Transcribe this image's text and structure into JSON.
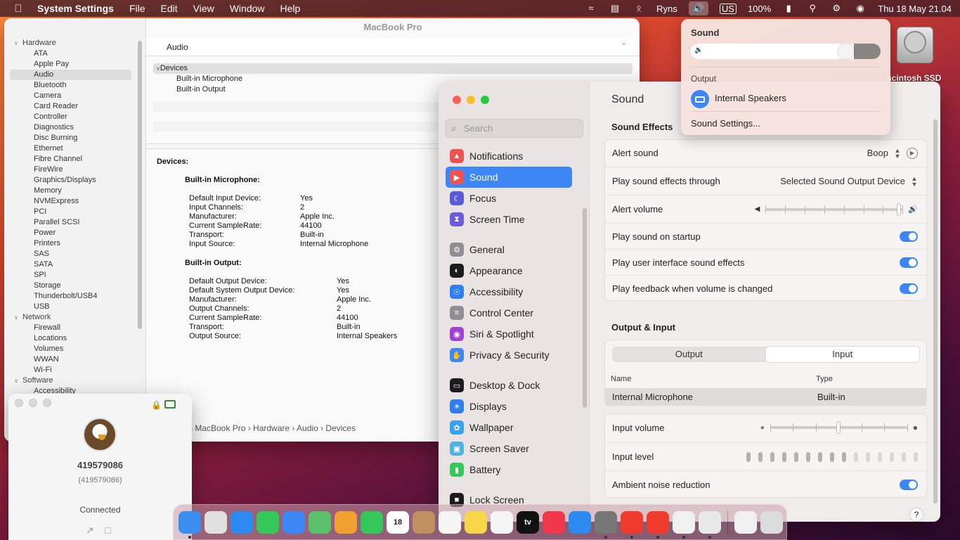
{
  "menubar": {
    "app": "System Settings",
    "menus": [
      "File",
      "Edit",
      "View",
      "Window",
      "Help"
    ],
    "user": "Ryns",
    "input_source": "US",
    "battery": "100%",
    "datetime": "Thu 18 May  21.04"
  },
  "sysinfo": {
    "title": "MacBook Pro",
    "header": "Audio",
    "sidebar": [
      {
        "label": "Hardware",
        "group": true
      },
      {
        "label": "ATA"
      },
      {
        "label": "Apple Pay"
      },
      {
        "label": "Audio",
        "selected": true
      },
      {
        "label": "Bluetooth"
      },
      {
        "label": "Camera"
      },
      {
        "label": "Card Reader"
      },
      {
        "label": "Controller"
      },
      {
        "label": "Diagnostics"
      },
      {
        "label": "Disc Burning"
      },
      {
        "label": "Ethernet"
      },
      {
        "label": "Fibre Channel"
      },
      {
        "label": "FireWire"
      },
      {
        "label": "Graphics/Displays"
      },
      {
        "label": "Memory"
      },
      {
        "label": "NVMExpress"
      },
      {
        "label": "PCI"
      },
      {
        "label": "Parallel SCSI"
      },
      {
        "label": "Power"
      },
      {
        "label": "Printers"
      },
      {
        "label": "SAS"
      },
      {
        "label": "SATA"
      },
      {
        "label": "SPI"
      },
      {
        "label": "Storage"
      },
      {
        "label": "Thunderbolt/USB4"
      },
      {
        "label": "USB"
      },
      {
        "label": "Network",
        "group": true
      },
      {
        "label": "Firewall"
      },
      {
        "label": "Locations"
      },
      {
        "label": "Volumes"
      },
      {
        "label": "WWAN"
      },
      {
        "label": "Wi-Fi"
      },
      {
        "label": "Software",
        "group": true
      },
      {
        "label": "Accessibility"
      }
    ],
    "tree": {
      "devices": "Devices",
      "mic": "Built-in Microphone",
      "out": "Built-in Output"
    },
    "detail": {
      "devices_label": "Devices:",
      "mic_title": "Built-in Microphone:",
      "mic": [
        [
          "Default Input Device:",
          "Yes"
        ],
        [
          "Input Channels:",
          "2"
        ],
        [
          "Manufacturer:",
          "Apple Inc."
        ],
        [
          "Current SampleRate:",
          "44100"
        ],
        [
          "Transport:",
          "Built-in"
        ],
        [
          "Input Source:",
          "Internal Microphone"
        ]
      ],
      "out_title": "Built-in Output:",
      "out": [
        [
          "Default Output Device:",
          "Yes"
        ],
        [
          "Default System Output Device:",
          "Yes"
        ],
        [
          "Manufacturer:",
          "Apple Inc."
        ],
        [
          "Output Channels:",
          "2"
        ],
        [
          "Current SampleRate:",
          "44100"
        ],
        [
          "Transport:",
          "Built-in"
        ],
        [
          "Output Source:",
          "Internal Speakers"
        ]
      ]
    },
    "breadcrumb": "s MacBook Pro › Hardware › Audio › Devices"
  },
  "anydesk": {
    "id": "419579086",
    "id_sub": "(419579086)",
    "status": "Connected"
  },
  "settings": {
    "search_placeholder": "Search",
    "nav": [
      {
        "label": "Notifications",
        "color": "#f0524f",
        "icon": "bell-icon"
      },
      {
        "label": "Sound",
        "color": "#f0524f",
        "icon": "speaker-icon",
        "active": true
      },
      {
        "label": "Focus",
        "color": "#5b5bd6",
        "icon": "moon-icon"
      },
      {
        "label": "Screen Time",
        "color": "#6a5bd6",
        "icon": "hourglass-icon"
      },
      {
        "label": "General",
        "color": "#8e8e93",
        "icon": "gear-icon"
      },
      {
        "label": "Appearance",
        "color": "#1c1c1e",
        "icon": "appearance-icon"
      },
      {
        "label": "Accessibility",
        "color": "#2d7ff0",
        "icon": "accessibility-icon"
      },
      {
        "label": "Control Center",
        "color": "#8e8e93",
        "icon": "control-center-icon"
      },
      {
        "label": "Siri & Spotlight",
        "color": "#a040d0",
        "icon": "siri-icon"
      },
      {
        "label": "Privacy & Security",
        "color": "#3d86f5",
        "icon": "hand-icon"
      },
      {
        "label": "Desktop & Dock",
        "color": "#1c1c1e",
        "icon": "dock-icon"
      },
      {
        "label": "Displays",
        "color": "#2d7ff0",
        "icon": "sun-icon"
      },
      {
        "label": "Wallpaper",
        "color": "#3aa0f0",
        "icon": "flower-icon"
      },
      {
        "label": "Screen Saver",
        "color": "#50b0e0",
        "icon": "screensaver-icon"
      },
      {
        "label": "Battery",
        "color": "#34c759",
        "icon": "battery-icon"
      },
      {
        "label": "Lock Screen",
        "color": "#1c1c1e",
        "icon": "lock-icon"
      }
    ],
    "title": "Sound",
    "effects_heading": "Sound Effects",
    "alert_sound_label": "Alert sound",
    "alert_sound_value": "Boop",
    "play_through_label": "Play sound effects through",
    "play_through_value": "Selected Sound Output Device",
    "alert_volume_label": "Alert volume",
    "alert_volume_level": 0.99,
    "startup_label": "Play sound on startup",
    "ui_effects_label": "Play user interface sound effects",
    "feedback_label": "Play feedback when volume is changed",
    "oi_heading": "Output & Input",
    "tabs": {
      "output": "Output",
      "input": "Input"
    },
    "col_name": "Name",
    "col_type": "Type",
    "device_name": "Internal Microphone",
    "device_type": "Built-in",
    "input_volume_label": "Input volume",
    "input_volume_level": 0.5,
    "input_level_label": "Input level",
    "input_level_lit": 9,
    "input_level_total": 15,
    "ambient_label": "Ambient noise reduction",
    "help": "?"
  },
  "popover": {
    "sound_heading": "Sound",
    "volume_level": 0.86,
    "output_heading": "Output",
    "device": "Internal Speakers",
    "settings_link": "Sound Settings..."
  },
  "desktop": {
    "disk_label": "acintosh SSD"
  },
  "dock": [
    {
      "name": "finder",
      "color": "#3a8ef0",
      "run": true
    },
    {
      "name": "launchpad",
      "color": "#e0e0e0"
    },
    {
      "name": "safari",
      "color": "#2d8af0"
    },
    {
      "name": "messages",
      "color": "#34c759"
    },
    {
      "name": "mail",
      "color": "#3d86f5"
    },
    {
      "name": "maps",
      "color": "#5ac06a"
    },
    {
      "name": "photos",
      "color": "#f0a030"
    },
    {
      "name": "facetime",
      "color": "#34c759"
    },
    {
      "name": "calendar",
      "color": "#ffffff",
      "label": "18"
    },
    {
      "name": "contacts",
      "color": "#c09060"
    },
    {
      "name": "reminders",
      "color": "#f5f5f5"
    },
    {
      "name": "notes",
      "color": "#f7d64a"
    },
    {
      "name": "freeform",
      "color": "#f5f5f5"
    },
    {
      "name": "tv",
      "color": "#111111",
      "label": "tv"
    },
    {
      "name": "music",
      "color": "#f2364c"
    },
    {
      "name": "app-store",
      "color": "#2d8af0"
    },
    {
      "name": "system-settings",
      "color": "#777777",
      "run": true
    },
    {
      "name": "anydesk",
      "color": "#ef3b2d",
      "run": true
    },
    {
      "name": "anydesk-2",
      "color": "#ef3b2d",
      "run": true
    },
    {
      "name": "script-editor",
      "color": "#f0f0f0",
      "run": true
    },
    {
      "name": "system-information",
      "color": "#e8e8e8",
      "run": true
    },
    {
      "name": "documents",
      "color": "#f0f0f0"
    },
    {
      "name": "trash",
      "color": "#dcdcdc"
    }
  ]
}
